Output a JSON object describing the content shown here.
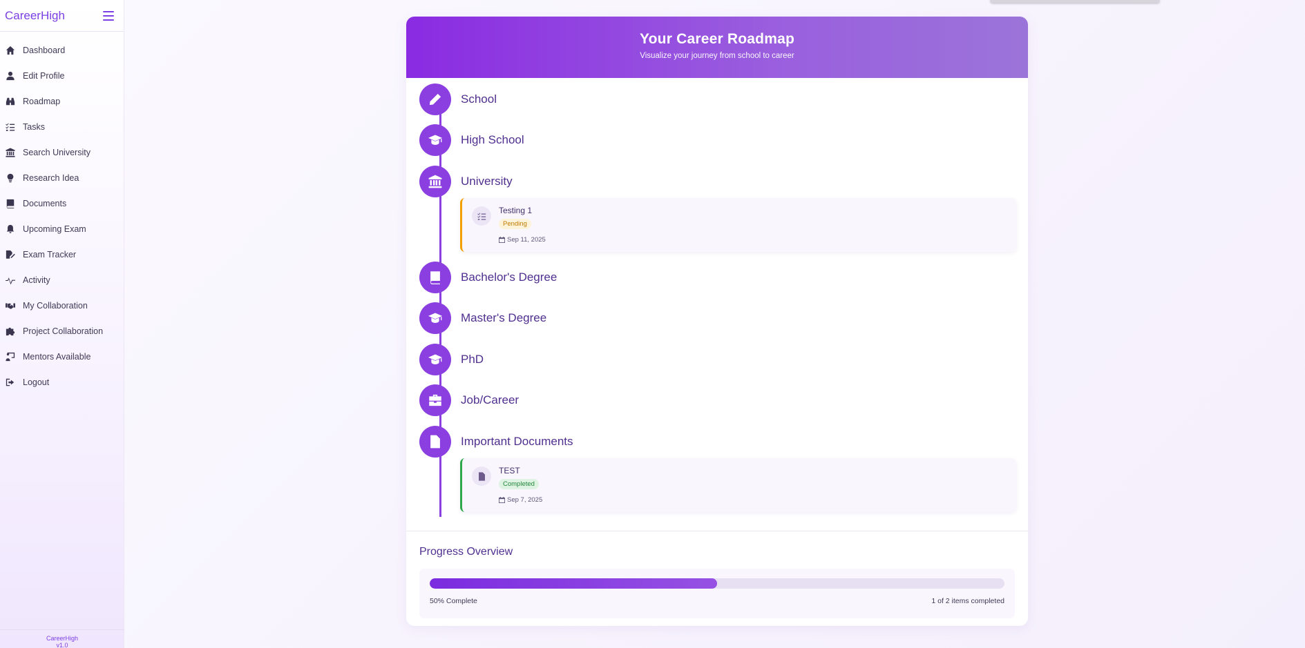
{
  "app": {
    "brand": "CareerHigh",
    "footer_brand": "CareerHigh",
    "version": "v1.0"
  },
  "sidebar": {
    "items": [
      {
        "label": "Dashboard",
        "icon": "home-icon"
      },
      {
        "label": "Edit Profile",
        "icon": "user-icon"
      },
      {
        "label": "Roadmap",
        "icon": "binoculars-icon"
      },
      {
        "label": "Tasks",
        "icon": "list-check-icon"
      },
      {
        "label": "Search University",
        "icon": "building-columns-icon"
      },
      {
        "label": "Research Idea",
        "icon": "lightbulb-icon"
      },
      {
        "label": "Documents",
        "icon": "book-icon"
      },
      {
        "label": "Upcoming Exam",
        "icon": "bell-icon"
      },
      {
        "label": "Exam Tracker",
        "icon": "file-signature-icon"
      },
      {
        "label": "Activity",
        "icon": "pulse-icon"
      },
      {
        "label": "My Collaboration",
        "icon": "handshake-icon"
      },
      {
        "label": "Project Collaboration",
        "icon": "puzzle-icon"
      },
      {
        "label": "Mentors Available",
        "icon": "chalkboard-user-icon"
      },
      {
        "label": "Logout",
        "icon": "logout-icon"
      }
    ]
  },
  "roadmap": {
    "title": "Your Career Roadmap",
    "subtitle": "Visualize your journey from school to career",
    "stages": [
      {
        "label": "School",
        "icon": "pencil-icon"
      },
      {
        "label": "High School",
        "icon": "graduation-cap-icon"
      },
      {
        "label": "University",
        "icon": "university-icon"
      },
      {
        "label": "Bachelor's Degree",
        "icon": "book-icon"
      },
      {
        "label": "Master's Degree",
        "icon": "graduation-cap-icon"
      },
      {
        "label": "PhD",
        "icon": "graduation-cap-icon"
      },
      {
        "label": "Job/Career",
        "icon": "briefcase-icon"
      },
      {
        "label": "Important Documents",
        "icon": "file-icon"
      }
    ],
    "items": [
      {
        "stage": "University",
        "title": "Testing 1",
        "status": "Pending",
        "date": "Sep 11, 2025",
        "icon": "list-check-icon",
        "accent": "#f2a000"
      },
      {
        "stage": "Important Documents",
        "title": "TEST",
        "status": "Completed",
        "date": "Sep 7, 2025",
        "icon": "file-icon",
        "accent": "#2ea84a"
      }
    ]
  },
  "progress": {
    "title": "Progress Overview",
    "percent": 50,
    "percent_label": "50% Complete",
    "count_label": "1 of 2 items completed"
  }
}
